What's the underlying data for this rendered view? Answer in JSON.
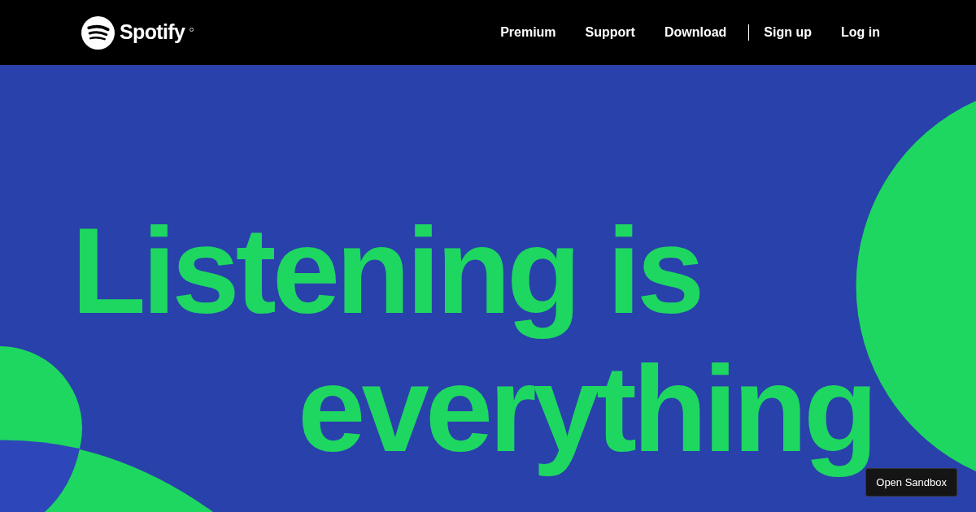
{
  "header": {
    "logo_text": "Spotify",
    "nav": [
      {
        "label": "Premium",
        "kind": "link"
      },
      {
        "label": "Support",
        "kind": "link"
      },
      {
        "label": "Download",
        "kind": "link"
      },
      {
        "label": "Sign up",
        "kind": "link"
      },
      {
        "label": "Log in",
        "kind": "link"
      }
    ]
  },
  "hero": {
    "headline_lines": [
      "Listening is",
      "everything"
    ]
  },
  "sandbox_button": "Open Sandbox"
}
